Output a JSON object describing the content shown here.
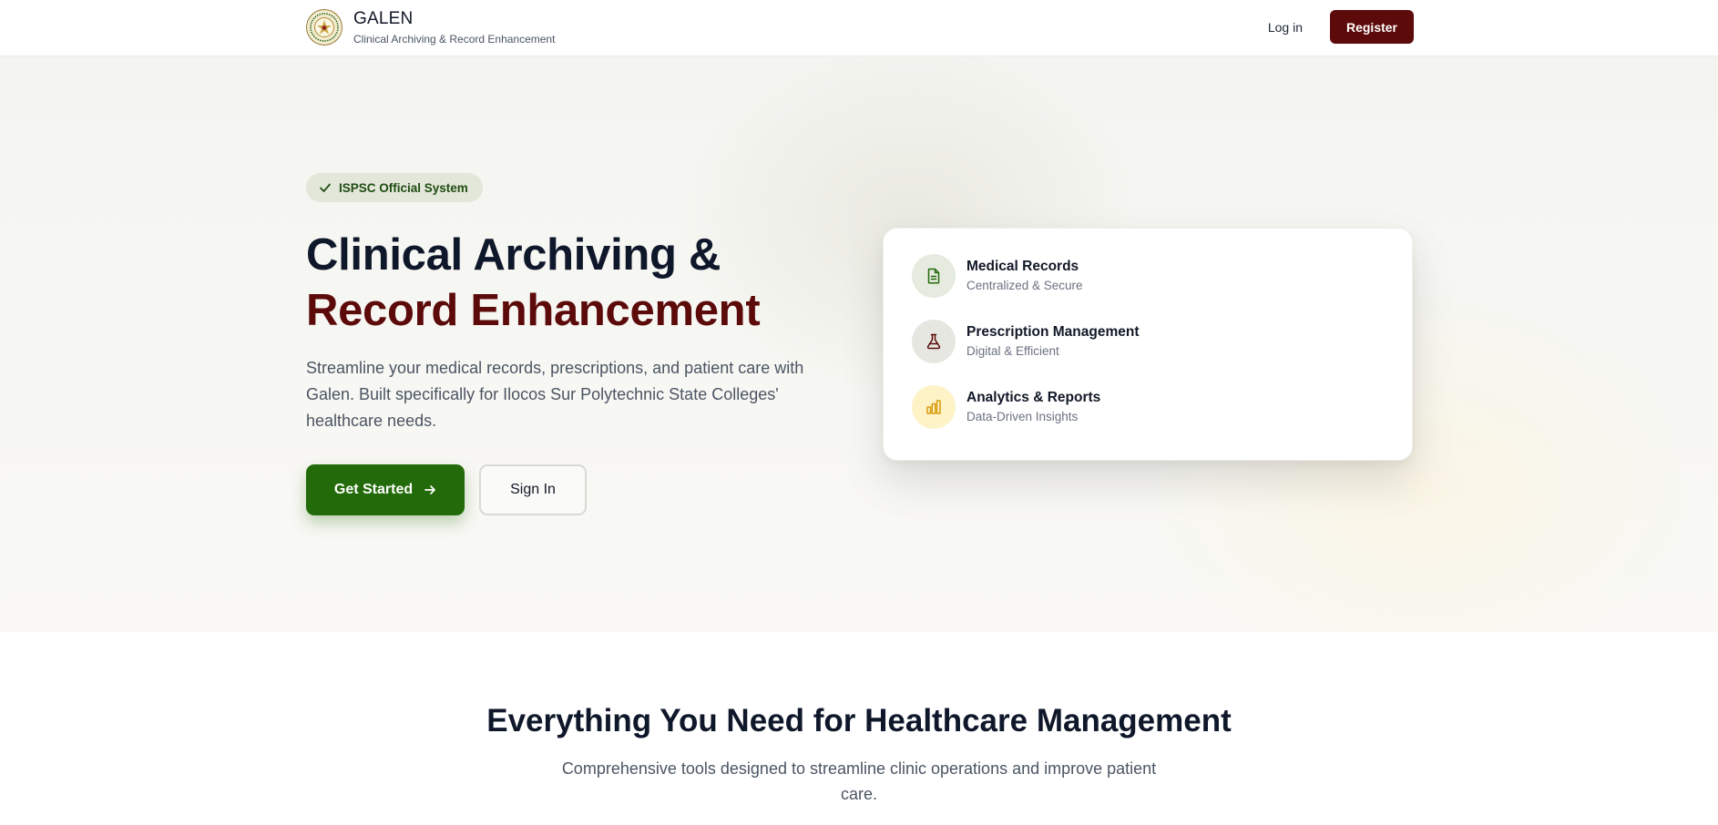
{
  "header": {
    "title": "GALEN",
    "subtitle": "Clinical Archiving & Record Enhancement",
    "login_label": "Log in",
    "register_label": "Register"
  },
  "hero": {
    "badge": "ISPSC Official System",
    "title_line1": "Clinical Archiving &",
    "title_line2": "Record Enhancement",
    "description": "Streamline your medical records, prescriptions, and patient care with Galen. Built specifically for Ilocos Sur Polytechnic State Colleges' healthcare needs.",
    "primary_button": "Get Started",
    "secondary_button": "Sign In"
  },
  "features": [
    {
      "title": "Medical Records",
      "subtitle": "Centralized & Secure",
      "icon": "document-icon"
    },
    {
      "title": "Prescription Management",
      "subtitle": "Digital & Efficient",
      "icon": "flask-icon"
    },
    {
      "title": "Analytics & Reports",
      "subtitle": "Data-Driven Insights",
      "icon": "bar-chart-icon"
    }
  ],
  "section": {
    "title": "Everything You Need for Healthcare Management",
    "description": "Comprehensive tools designed to streamline clinic operations and improve patient care."
  },
  "colors": {
    "maroon": "#5c0a0a",
    "green": "#236b0a",
    "badge_bg": "#e3e7d9",
    "gold": "#d99a0b"
  }
}
